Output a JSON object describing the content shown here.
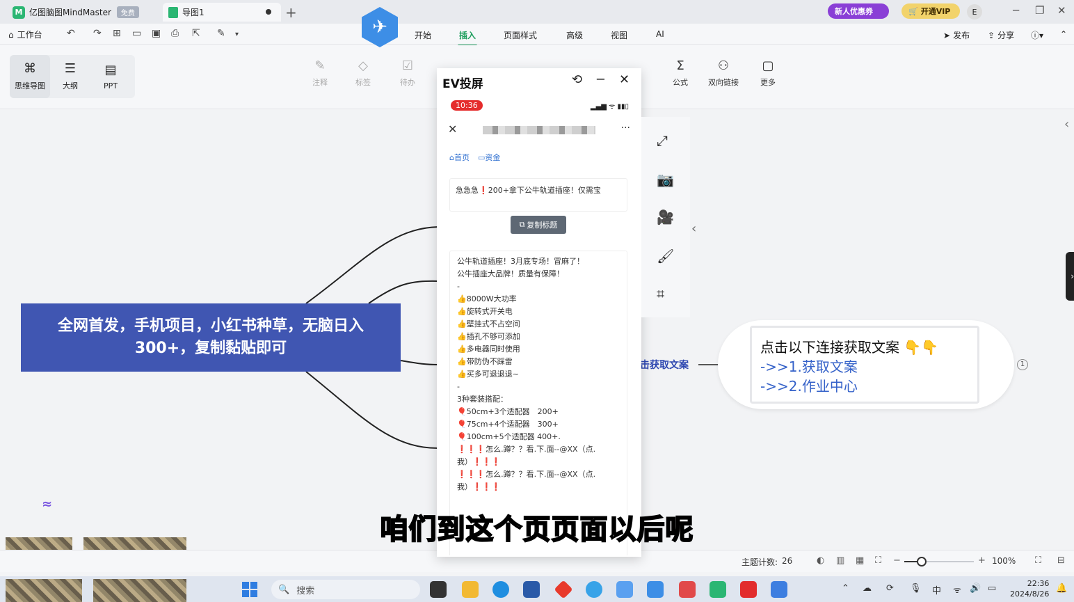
{
  "titlebar": {
    "app_name": "亿图脑图MindMaster",
    "free_badge": "免费",
    "doc_tab": "导图1",
    "new_tab_icon": "plus-icon",
    "promo_new_user": "新人优惠券",
    "promo_vip": "开通VIP",
    "user_initial": "E"
  },
  "menubar": {
    "workspace": "工作台",
    "tabs": [
      "开始",
      "插入",
      "页面样式",
      "高级",
      "视图",
      "AI"
    ],
    "active_tab": "插入",
    "publish": "发布",
    "share": "分享"
  },
  "ribbon": {
    "views": [
      {
        "label": "思维导图",
        "icon": "mindmap-icon"
      },
      {
        "label": "大纲",
        "icon": "outline-icon"
      },
      {
        "label": "PPT",
        "icon": "ppt-icon"
      }
    ],
    "buttons_left": [
      {
        "label": "注释",
        "icon": "pen-icon"
      },
      {
        "label": "标签",
        "icon": "tag-icon"
      },
      {
        "label": "待办",
        "icon": "todo-icon"
      }
    ],
    "buttons_right": [
      {
        "label": "公式",
        "icon": "sigma-icon"
      },
      {
        "label": "双向链接",
        "icon": "link-tree-icon"
      },
      {
        "label": "更多",
        "icon": "more-icon"
      }
    ]
  },
  "mindmap": {
    "root": "全网首发，手机项目，小红书种草，无脑日入300+，复制黏贴即可",
    "branch_label": "击获取文案",
    "callout": {
      "line1": "点击以下连接获取文案 👇👇",
      "line2": "->>1.获取文案",
      "line3": "->>2.作业中心"
    }
  },
  "ev_window": {
    "title": "EV投屏",
    "phone": {
      "time": "10:36",
      "nav_home": "首页",
      "nav_funds": "资金",
      "card_text": "急急急❗200+拿下公牛轨道插座！仅需宝",
      "copy_button": "复制标题",
      "body_lines": [
        "公牛轨道插座！3月底专场！冒麻了！",
        "公牛插座大品牌！质量有保障！",
        "-",
        "👍8000W大功率",
        "👍旋转式开关电",
        "👍壁挂式不占空间",
        "👍插孔不够可添加",
        "👍多电器同时使用",
        "👍带防伪不踩雷",
        "👍买多可退退退~",
        "-",
        "3种套装搭配：",
        "🎈50cm+3个适配器　200+",
        "🎈75cm+4个适配器　300+",
        "🎈100cm+5个适配器 400+.",
        "❗❗❗怎么.蹲？？看.下.面--@XX（点.",
        "我）❗❗❗",
        "❗❗❗怎么.蹲？？看.下.面--@XX（点.",
        "我）❗❗❗"
      ]
    }
  },
  "subtitle": "咱们到这个页页面以后呢",
  "statusbar": {
    "topic_count_label": "主题计数:",
    "topic_count": "26",
    "zoom": "100%",
    "zoom_level_fraction": 0.25
  },
  "taskbar": {
    "search": "搜索",
    "ime": "中",
    "time": "22:36",
    "date": "2024/8/26"
  }
}
